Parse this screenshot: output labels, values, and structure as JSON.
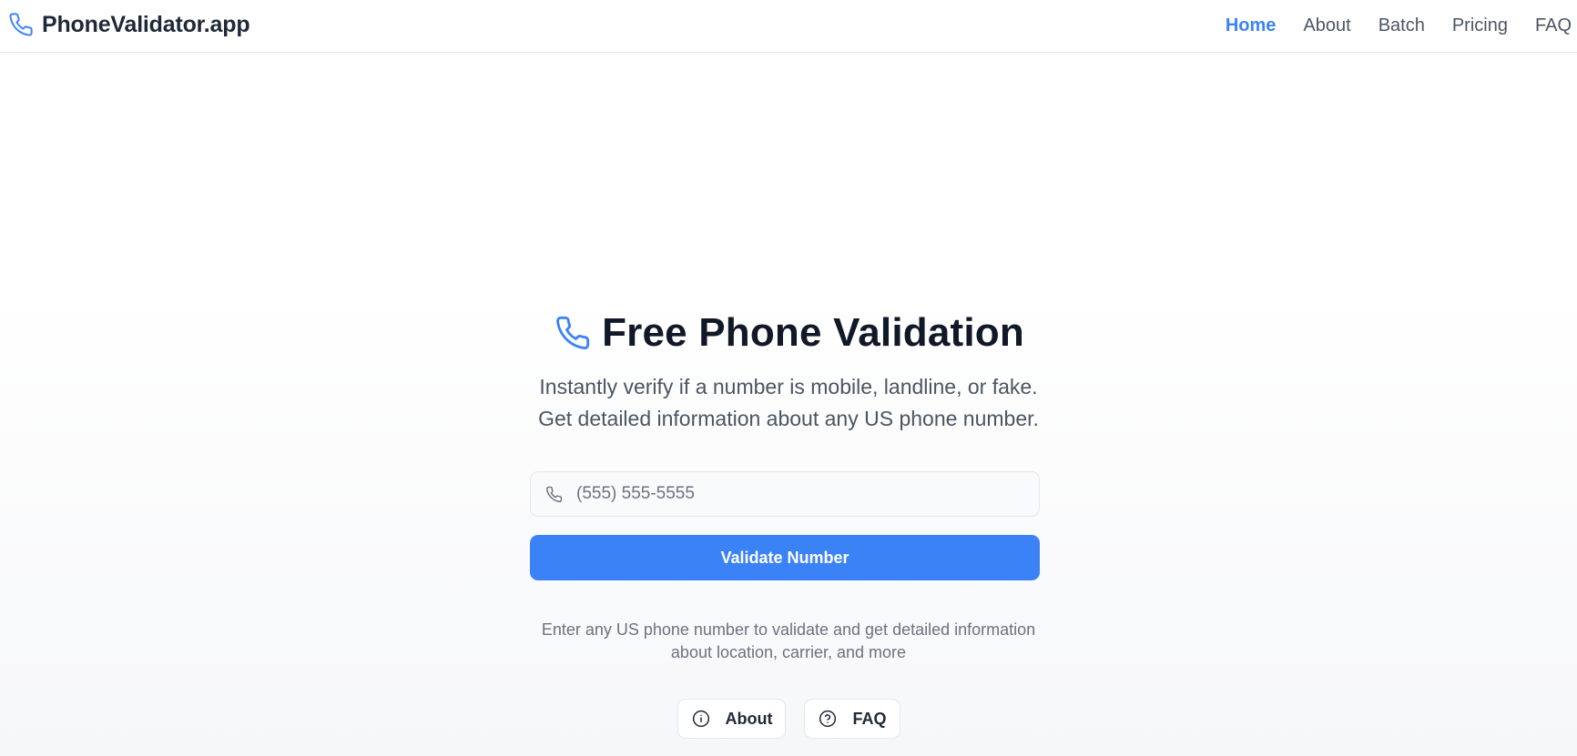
{
  "header": {
    "brand_name": "PhoneValidator.app",
    "brand_icon": "phone-icon",
    "nav": [
      {
        "label": "Home",
        "active": true
      },
      {
        "label": "About",
        "active": false
      },
      {
        "label": "Batch",
        "active": false
      },
      {
        "label": "Pricing",
        "active": false
      },
      {
        "label": "FAQ",
        "active": false
      }
    ]
  },
  "hero": {
    "title": "Free Phone Validation",
    "title_icon": "phone-icon",
    "subtitle_line1": "Instantly verify if a number is mobile, landline, or fake.",
    "subtitle_line2": "Get detailed information about any US phone number.",
    "input": {
      "placeholder": "(555) 555-5555",
      "value": "",
      "icon": "phone-icon"
    },
    "validate_label": "Validate Number",
    "helper_line1": "Enter any US phone number to validate and get detailed information",
    "helper_line2": "about location, carrier, and more",
    "chips": [
      {
        "label": "About",
        "icon": "info-icon"
      },
      {
        "label": "FAQ",
        "icon": "question-icon"
      }
    ]
  },
  "colors": {
    "accent": "#3b82f6",
    "text_primary": "#111827",
    "text_muted": "#6b7280",
    "border": "#e5e7eb"
  }
}
